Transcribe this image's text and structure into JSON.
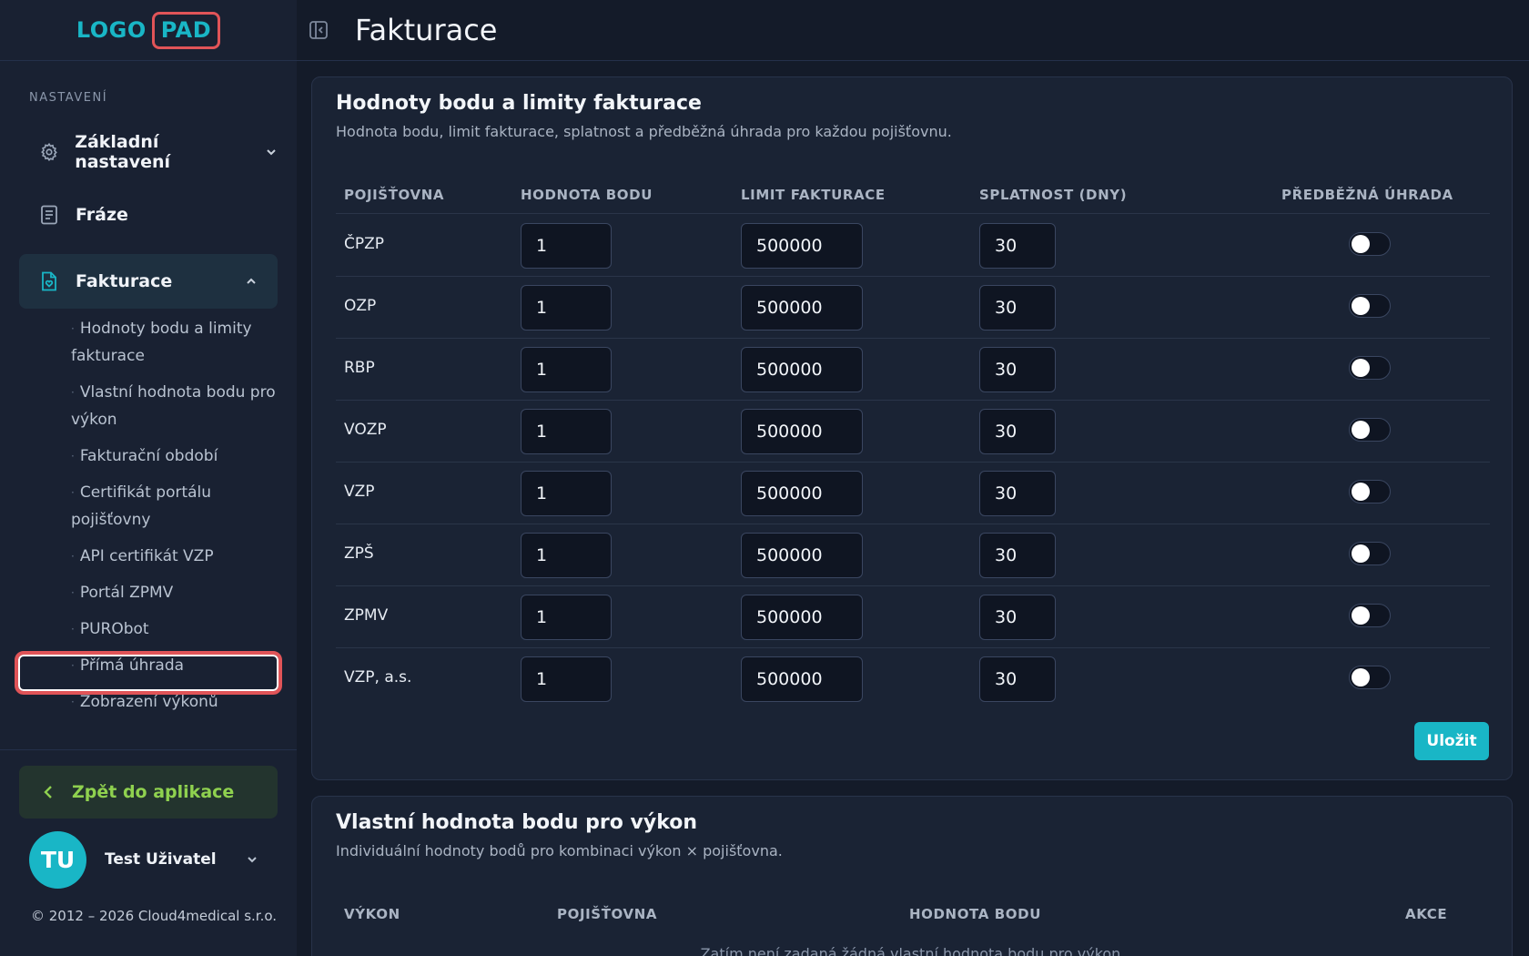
{
  "logo": {
    "part1": "LOGO",
    "part2": "PAD"
  },
  "sidebar": {
    "section_label": "NASTAVENÍ",
    "nav": [
      {
        "label": "Základní nastavení",
        "icon": "gear-icon"
      },
      {
        "label": "Fráze",
        "icon": "document-icon"
      },
      {
        "label": "Fakturace",
        "icon": "invoice-icon"
      }
    ],
    "sub_items": [
      "Hodnoty bodu a limity fakturace",
      "Vlastní hodnota bodu pro výkon",
      "Fakturační období",
      "Certifikát portálu pojišťovny",
      "API certifikát VZP",
      "Portál ZPMV",
      "PURObot",
      "Přímá úhrada",
      "Zobrazení výkonů"
    ],
    "back_label": "Zpět do aplikace",
    "user": {
      "initials": "TU",
      "name": "Test Uživatel"
    },
    "copyright": "© 2012 – 2026 Cloud4medical s.r.o."
  },
  "header": {
    "title": "Fakturace"
  },
  "card1": {
    "title": "Hodnoty bodu a limity fakturace",
    "subtitle": "Hodnota bodu, limit fakturace, splatnost a předběžná úhrada pro každou pojišťovnu.",
    "columns": [
      "POJIŠŤOVNA",
      "HODNOTA BODU",
      "LIMIT FAKTURACE",
      "SPLATNOST (DNY)",
      "PŘEDBĚŽNÁ ÚHRADA"
    ],
    "rows": [
      {
        "name": "ČPZP",
        "point": "1",
        "limit": "500000",
        "due": "30",
        "prepay": false
      },
      {
        "name": "OZP",
        "point": "1",
        "limit": "500000",
        "due": "30",
        "prepay": false
      },
      {
        "name": "RBP",
        "point": "1",
        "limit": "500000",
        "due": "30",
        "prepay": false
      },
      {
        "name": "VOZP",
        "point": "1",
        "limit": "500000",
        "due": "30",
        "prepay": false
      },
      {
        "name": "VZP",
        "point": "1",
        "limit": "500000",
        "due": "30",
        "prepay": false
      },
      {
        "name": "ZPŠ",
        "point": "1",
        "limit": "500000",
        "due": "30",
        "prepay": false
      },
      {
        "name": "ZPMV",
        "point": "1",
        "limit": "500000",
        "due": "30",
        "prepay": false
      },
      {
        "name": "VZP, a.s.",
        "point": "1",
        "limit": "500000",
        "due": "30",
        "prepay": false
      }
    ],
    "save_label": "Uložit"
  },
  "card2": {
    "title": "Vlastní hodnota bodu pro výkon",
    "subtitle": "Individuální hodnoty bodů pro kombinaci výkon × pojišťovna.",
    "columns": [
      "VÝKON",
      "POJIŠŤOVNA",
      "HODNOTA BODU",
      "AKCE"
    ],
    "empty_text": "Zatím není zadaná žádná vlastní hodnota bodu pro výkon."
  },
  "colors": {
    "accent": "#19b6c6",
    "back_green": "#8fd14f",
    "highlight": "#e05458"
  }
}
